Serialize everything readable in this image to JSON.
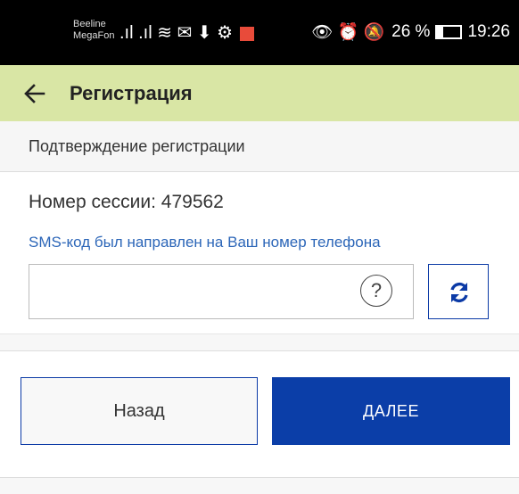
{
  "status_bar": {
    "carrier_1": "Beeline",
    "carrier_2": "MegaFon",
    "left_icons": ".ıl .ıl ≋ ✉ ⬇ ⚙",
    "right_icons": "👁 ⏰ 🔕",
    "battery_text": "26 %",
    "battery_level": 0.26,
    "time": "19:26"
  },
  "app_bar": {
    "title": "Регистрация",
    "back_icon": "arrow-left-icon"
  },
  "subheader": {
    "title": "Подтверждение регистрации"
  },
  "session": {
    "label": "Номер сессии: 479562"
  },
  "sms_info": "SMS-код был направлен на Ваш номер телефона",
  "code_input": {
    "value": "",
    "placeholder": "",
    "help_icon": "?"
  },
  "buttons": {
    "back": "Назад",
    "next": "ДАЛЕЕ"
  },
  "colors": {
    "app_bar_bg": "#d9e6a5",
    "primary": "#0b3ea8",
    "link": "#2c66b8"
  }
}
